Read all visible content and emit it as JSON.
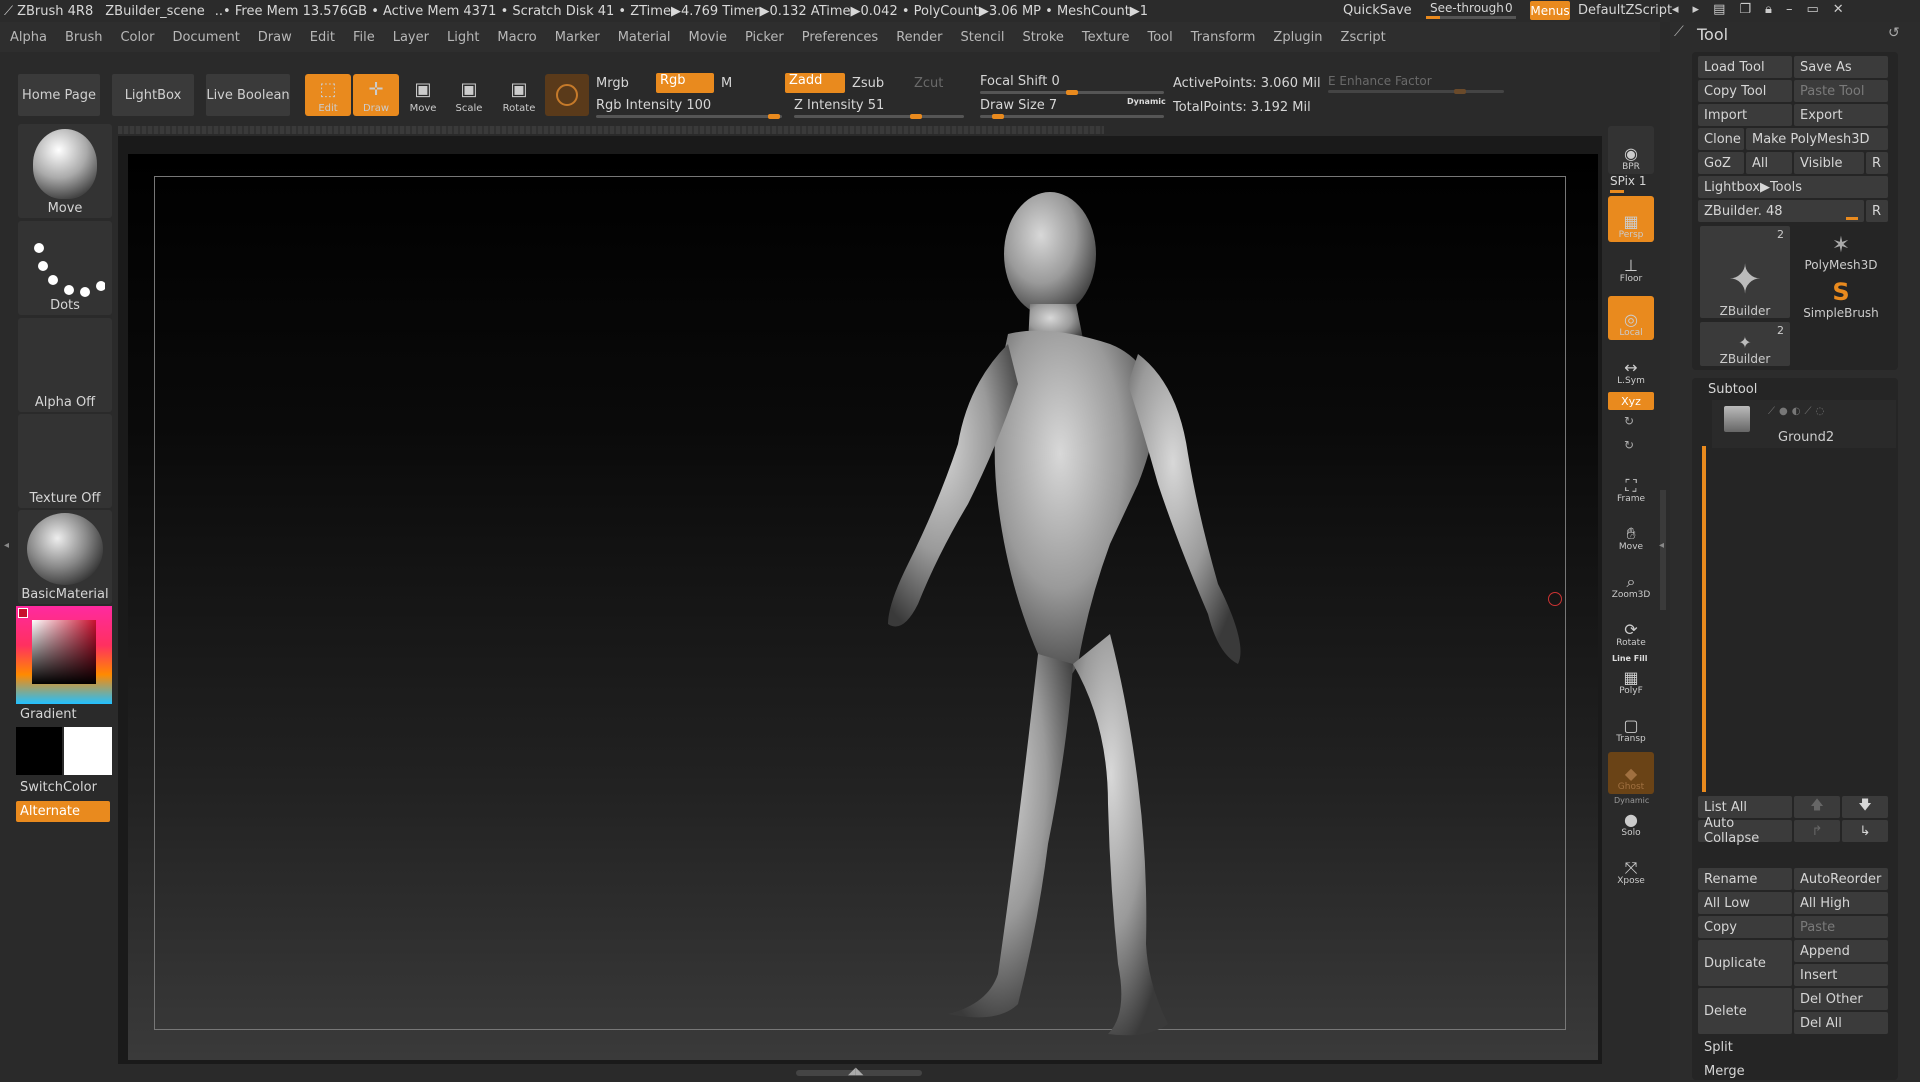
{
  "titlebar": {
    "app": "ZBrush 4R8",
    "scene": "ZBuilder_scene",
    "stats": "..• Free Mem 13.576GB • Active Mem 4371 • Scratch Disk 41 • ZTime▶4.769 Timer▶0.132 ATime▶0.042 • PolyCount▶3.06 MP • MeshCount▶1",
    "quicksave": "QuickSave",
    "seethrough_label": "See-through",
    "seethrough_value": "0",
    "menus": "Menus",
    "script": "DefaultZScript"
  },
  "menubar": [
    "Alpha",
    "Brush",
    "Color",
    "Document",
    "Draw",
    "Edit",
    "File",
    "Layer",
    "Light",
    "Macro",
    "Marker",
    "Material",
    "Movie",
    "Picker",
    "Preferences",
    "Render",
    "Stencil",
    "Stroke",
    "Texture",
    "Tool",
    "Transform",
    "Zplugin",
    "Zscript"
  ],
  "shelf": {
    "home": "Home Page",
    "lightbox": "LightBox",
    "live_boolean": "Live Boolean",
    "edit": "Edit",
    "draw": "Draw",
    "move": "Move",
    "scale": "Scale",
    "rotate": "Rotate",
    "mrgb": "Mrgb",
    "rgb": "Rgb",
    "m": "M",
    "zadd": "Zadd",
    "zsub": "Zsub",
    "zcut": "Zcut",
    "rgb_intensity": "Rgb Intensity 100",
    "z_intensity": "Z Intensity 51",
    "focal_shift": "Focal Shift 0",
    "draw_size": "Draw Size 7",
    "dynamic": "Dynamic",
    "active_points": "ActivePoints: 3.060 Mil",
    "total_points": "TotalPoints: 3.192 Mil",
    "enhance": "E Enhance Factor"
  },
  "left": {
    "brush": "Move",
    "stroke": "Dots",
    "alpha": "Alpha Off",
    "texture": "Texture Off",
    "material": "BasicMaterial",
    "gradient": "Gradient",
    "switch": "SwitchColor",
    "alternate": "Alternate"
  },
  "rightshelf": {
    "bpr": "BPR",
    "spix": "SPix 1",
    "persp": "Persp",
    "floor": "Floor",
    "local": "Local",
    "lsym": "L.Sym",
    "xyz": "Xyz",
    "frame": "Frame",
    "move": "Move",
    "zoom": "Zoom3D",
    "rotate": "Rotate",
    "linefill": "Line Fill",
    "polyf": "PolyF",
    "transp": "Transp",
    "ghost": "Ghost",
    "dynamic": "Dynamic",
    "solo": "Solo",
    "xpose": "Xpose"
  },
  "tool": {
    "title": "Tool",
    "load": "Load Tool",
    "save_as": "Save As",
    "copy": "Copy Tool",
    "paste": "Paste Tool",
    "import": "Import",
    "export": "Export",
    "clone": "Clone",
    "make_poly": "Make PolyMesh3D",
    "goz": "GoZ",
    "all": "All",
    "visible": "Visible",
    "r": "R",
    "lightbox_tools": "Lightbox▶Tools",
    "zbuilder_slider": "ZBuilder. 48",
    "thumb1": "ZBuilder",
    "thumb1_count": "2",
    "thumb2": "PolyMesh3D",
    "thumb3": "SimpleBrush",
    "thumb4": "ZBuilder",
    "thumb4_count": "2"
  },
  "subtool": {
    "title": "Subtool",
    "item": "Ground2",
    "list_all": "List All",
    "auto_collapse": "Auto Collapse",
    "rename": "Rename",
    "autoreorder": "AutoReorder",
    "all_low": "All Low",
    "all_high": "All High",
    "copy": "Copy",
    "paste": "Paste",
    "duplicate": "Duplicate",
    "append": "Append",
    "insert": "Insert",
    "delete": "Delete",
    "del_other": "Del Other",
    "del_all": "Del All",
    "split": "Split",
    "merge": "Merge"
  },
  "colors": {
    "accent": "#e98a1e",
    "bg": "#2a2a2a"
  }
}
